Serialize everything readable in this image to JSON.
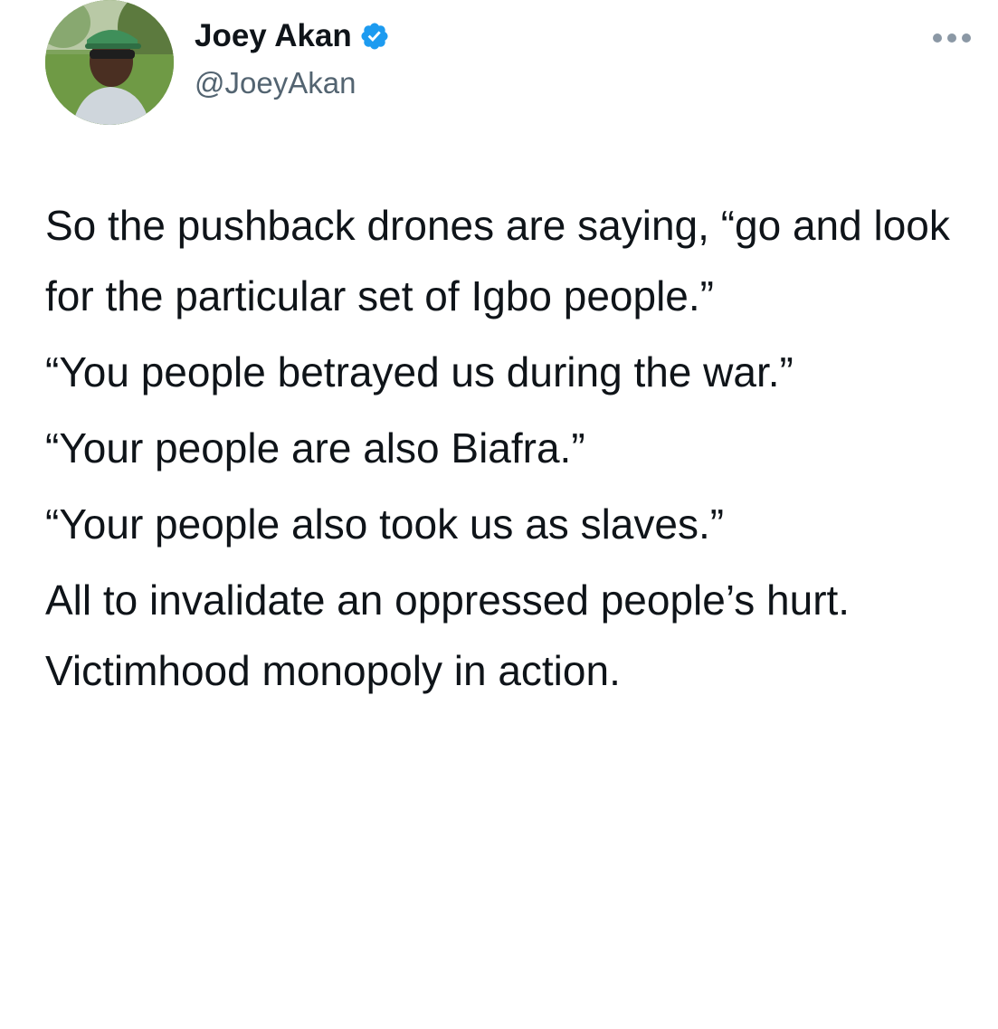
{
  "tweet": {
    "author": {
      "display_name": "Joey Akan",
      "handle": "@JoeyAkan",
      "verified": true,
      "avatar_icon": "user-avatar-photo"
    },
    "more_icon": "more-horizontal-icon",
    "paragraphs": [
      "So the pushback drones are saying, “go and look for the particular set of Igbo people.”",
      "“You people betrayed us during the war.”",
      "“Your people are also Biafra.”",
      "“Your people also took us as slaves.”",
      "All to invalidate an oppressed people’s hurt.  Victimhood monopoly in action."
    ]
  },
  "colors": {
    "verified_badge": "#1d9bf0",
    "handle": "#536471",
    "text": "#0f1419"
  }
}
